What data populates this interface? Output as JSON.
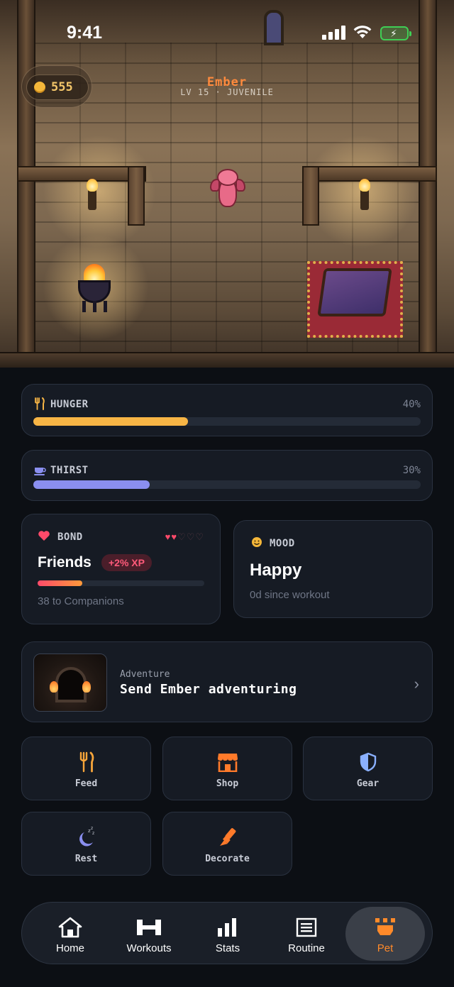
{
  "status_bar": {
    "time": "9:41"
  },
  "scene": {
    "coins": "555",
    "pet_name": "Ember",
    "pet_level": "LV 15 · JUVENILE"
  },
  "stats": {
    "hunger": {
      "label": "HUNGER",
      "value": "40%",
      "level": 0.4,
      "color": "#f7b545"
    },
    "thirst": {
      "label": "THIRST",
      "value": "30%",
      "level": 0.3,
      "color": "#8a8ff0"
    }
  },
  "bond": {
    "label": "BOND",
    "level_name": "Friends",
    "xp_badge": "+2% XP",
    "hearts_filled": 2,
    "hearts_total": 5,
    "progress": 0.27,
    "next": "38 to Companions"
  },
  "mood": {
    "label": "MOOD",
    "value": "Happy",
    "since": "0d since workout"
  },
  "adventure": {
    "eyebrow": "Adventure",
    "title": "Send Ember adventuring"
  },
  "actions": [
    {
      "label": "Feed",
      "icon": "fork-knife-icon"
    },
    {
      "label": "Shop",
      "icon": "shop-icon"
    },
    {
      "label": "Gear",
      "icon": "shield-icon"
    },
    {
      "label": "Rest",
      "icon": "moon-sleep-icon"
    },
    {
      "label": "Decorate",
      "icon": "brush-icon"
    }
  ],
  "tabs": [
    {
      "label": "Home",
      "icon": "home-icon"
    },
    {
      "label": "Workouts",
      "icon": "dumbbell-icon"
    },
    {
      "label": "Stats",
      "icon": "bar-chart-icon"
    },
    {
      "label": "Routine",
      "icon": "list-icon"
    },
    {
      "label": "Pet",
      "icon": "paw-icon",
      "active": true
    }
  ],
  "colors": {
    "accent": "#ff8a2a",
    "hunger": "#f7b545",
    "thirst": "#8a8ff0",
    "bond": "#ff4a6a",
    "background": "#0c0f14",
    "card": "#161b24"
  }
}
